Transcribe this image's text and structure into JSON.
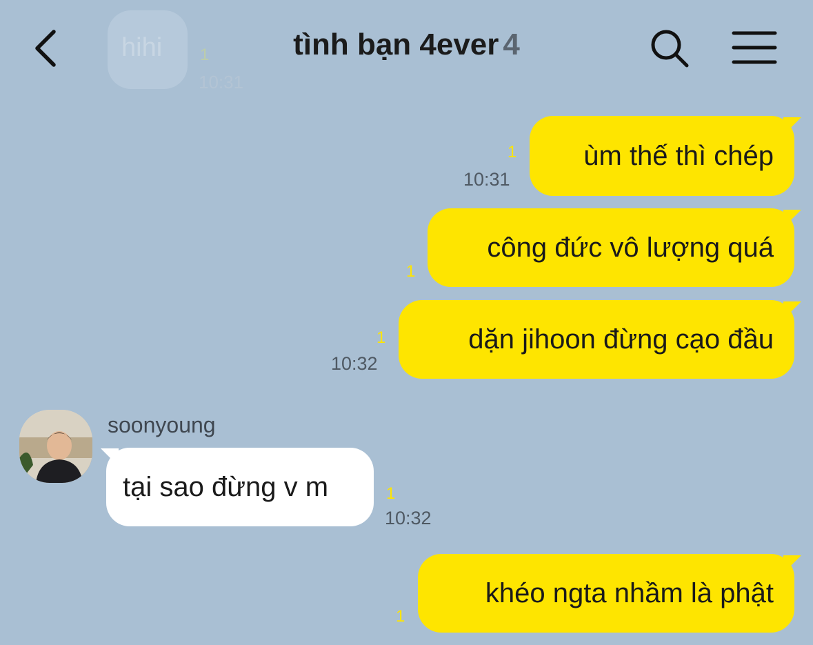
{
  "header": {
    "title": "tình bạn 4ever",
    "member_count": "4"
  },
  "ghost_message": {
    "text": "hihi",
    "unread": "1",
    "time": "10:31"
  },
  "messages": [
    {
      "sender": "me",
      "text": "ùm thế thì chép",
      "unread": "1",
      "time": "10:31"
    },
    {
      "sender": "me",
      "text": "công đức vô lượng quá",
      "unread": "1",
      "time": ""
    },
    {
      "sender": "me",
      "text": "dặn jihoon đừng cạo đầu",
      "unread": "1",
      "time": "10:32"
    },
    {
      "sender": "soonyoung",
      "text": "tại sao đừng v m",
      "unread": "1",
      "time": "10:32"
    },
    {
      "sender": "me",
      "text": "khéo ngta nhầm là phật",
      "unread": "1",
      "time": ""
    }
  ],
  "colors": {
    "background": "#a9bfd3",
    "my_bubble": "#fee500",
    "their_bubble": "#ffffff",
    "unread_count": "#fee500"
  },
  "icons": [
    "back-icon",
    "search-icon",
    "menu-icon"
  ]
}
